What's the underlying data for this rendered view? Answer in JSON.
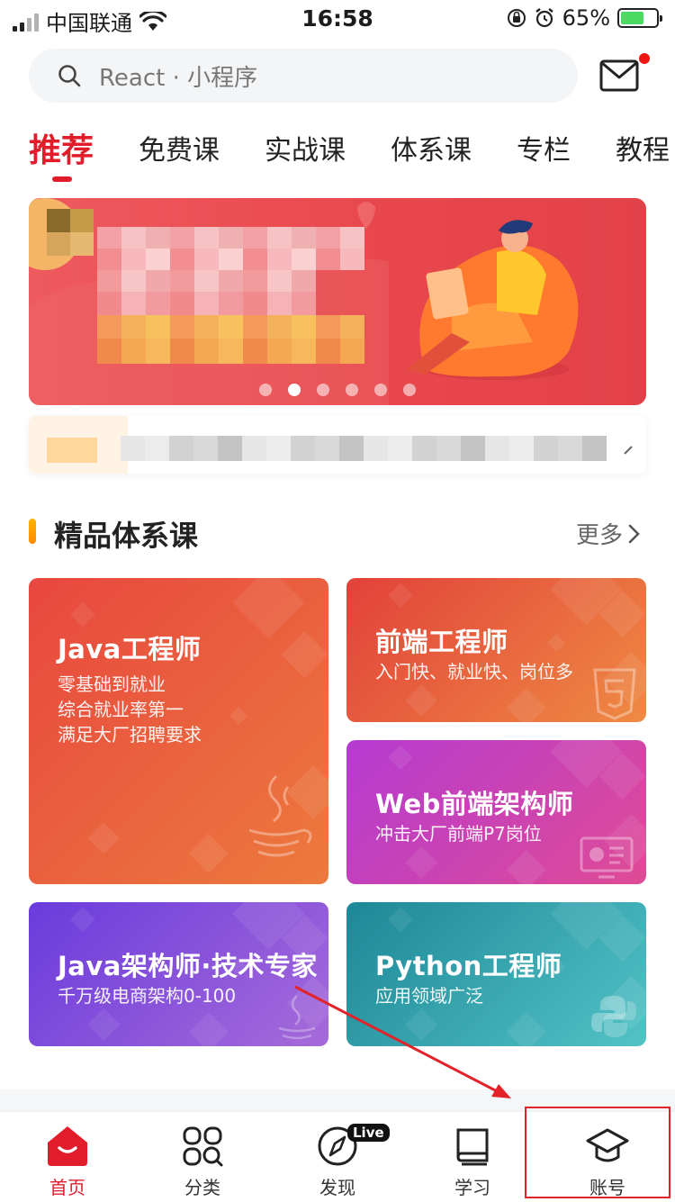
{
  "status_bar": {
    "carrier": "中国联通",
    "time": "16:58",
    "battery": "65%",
    "battery_level": 0.65
  },
  "search": {
    "placeholder": "React · 小程序",
    "icon": "search-icon"
  },
  "mail": {
    "icon": "mail-icon",
    "has_unread": true
  },
  "tabs": [
    {
      "label": "推荐",
      "active": true
    },
    {
      "label": "免费课"
    },
    {
      "label": "实战课"
    },
    {
      "label": "体系课"
    },
    {
      "label": "专栏"
    },
    {
      "label": "教程"
    }
  ],
  "banner": {
    "active_index": 1,
    "dot_count": 6
  },
  "section": {
    "title": "精品体系课",
    "more": "更多"
  },
  "cards": [
    {
      "title": "Java工程师",
      "lines": [
        "零基础到就业",
        "综合就业率第一",
        "满足大厂招聘要求"
      ],
      "colors": [
        "#e8473f",
        "#ec7a3d"
      ],
      "icon": "java-cup-icon"
    },
    {
      "title": "前端工程师",
      "lines": [
        "入门快、就业快、岗位多"
      ],
      "colors": [
        "#e2413a",
        "#ee8a43"
      ],
      "icon": "html5-icon"
    },
    {
      "title": "Web前端架构师",
      "lines": [
        "冲击大厂前端P7岗位"
      ],
      "colors": [
        "#b53bd1",
        "#df4b95"
      ],
      "icon": "slides-icon"
    },
    {
      "title": "Java架构师·技术专家",
      "lines": [
        "千万级电商架构0-100"
      ],
      "colors": [
        "#6a3bdc",
        "#a66bd9"
      ],
      "icon": "java-cup-icon"
    },
    {
      "title": "Python工程师",
      "lines": [
        "应用领域广泛"
      ],
      "colors": [
        "#1d8797",
        "#53c3c6"
      ],
      "icon": "python-icon"
    }
  ],
  "bottom_nav": [
    {
      "label": "首页",
      "icon": "home-icon",
      "active": true
    },
    {
      "label": "分类",
      "icon": "grid-icon"
    },
    {
      "label": "发现",
      "icon": "compass-icon",
      "badge": "Live"
    },
    {
      "label": "学习",
      "icon": "book-icon"
    },
    {
      "label": "账号",
      "icon": "graduation-cap-icon"
    }
  ],
  "accent": "#e11d2b"
}
